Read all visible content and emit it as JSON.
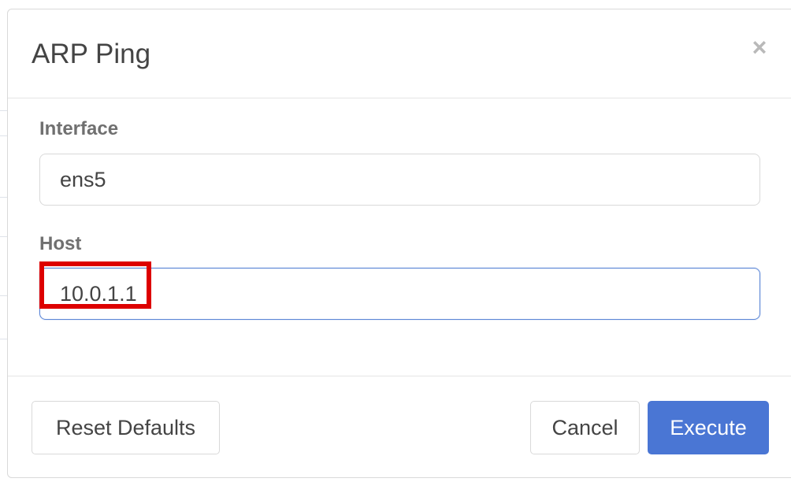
{
  "dialog": {
    "title": "ARP Ping",
    "close_symbol": "×"
  },
  "form": {
    "interface": {
      "label": "Interface",
      "value": "ens5"
    },
    "host": {
      "label": "Host",
      "value": "10.0.1.1"
    }
  },
  "footer": {
    "reset_label": "Reset Defaults",
    "cancel_label": "Cancel",
    "execute_label": "Execute"
  },
  "colors": {
    "primary": "#4a76d4",
    "focus_border": "#5b86d6",
    "highlight": "#dd0000"
  }
}
